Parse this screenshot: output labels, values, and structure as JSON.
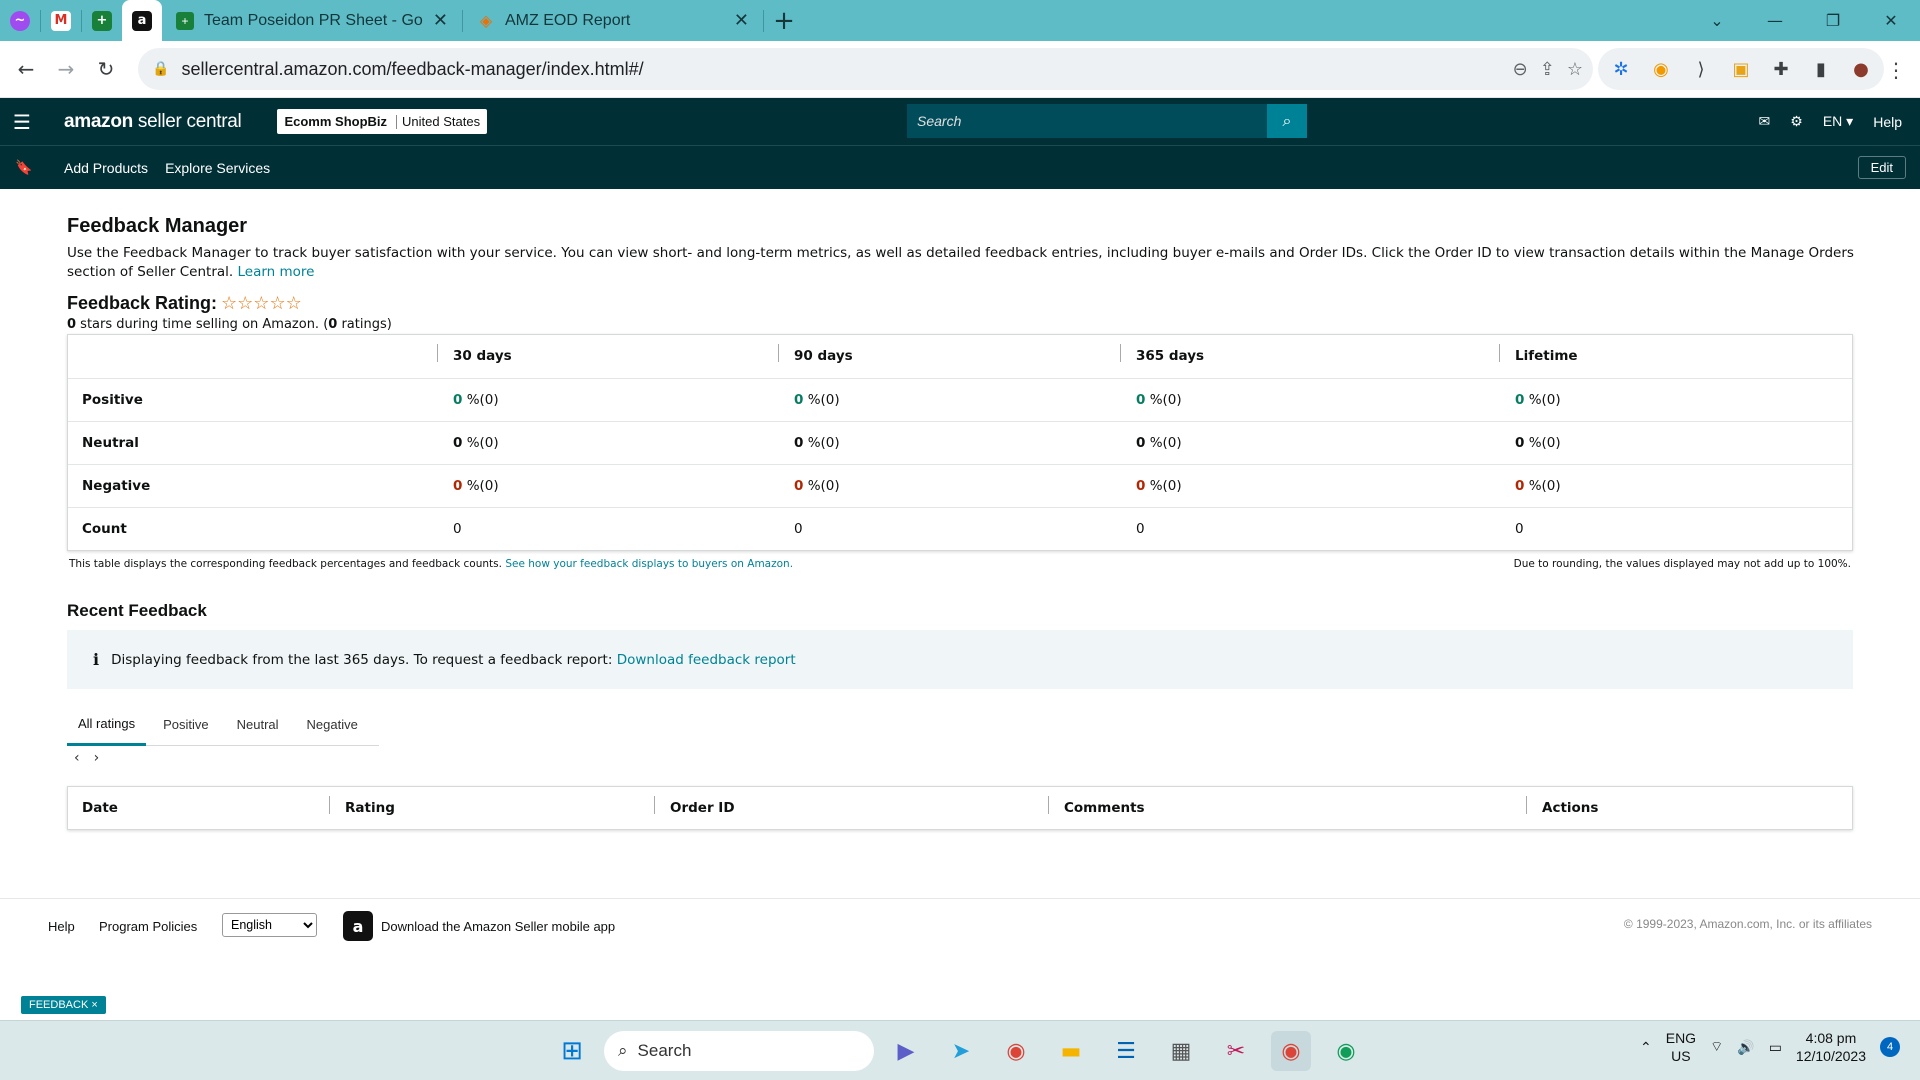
{
  "browser": {
    "tabs": [
      {
        "title": "Team Poseidon PR Sheet - Goog",
        "icon": "google-sheets-icon"
      },
      {
        "title": "AMZ EOD Report",
        "icon": "apps-script-icon"
      }
    ],
    "url": "sellercentral.amazon.com/feedback-manager/index.html#/"
  },
  "header": {
    "logo_main": "amazon",
    "logo_sub": " seller central",
    "store_name": "Ecomm ShopBiz",
    "store_region": "United States",
    "search_placeholder": "Search",
    "language": "EN ▾",
    "help": "Help"
  },
  "subnav": {
    "add_products": "Add Products",
    "explore_services": "Explore Services",
    "edit": "Edit"
  },
  "page": {
    "title": "Feedback Manager",
    "description": "Use the Feedback Manager to track buyer satisfaction with your service. You can view short- and long-term metrics, as well as detailed feedback entries, including buyer e-mails and Order IDs. Click the Order ID to view transaction details within the Manage Orders section of Seller Central.",
    "learn_more": "Learn more",
    "rating_heading": "Feedback Rating:",
    "stars_display": "☆☆☆☆☆",
    "rating_value": "0",
    "rating_text_1": " stars during time selling on Amazon. (",
    "rating_count": "0",
    "rating_text_2": " ratings)"
  },
  "metrics": {
    "columns": [
      "30 days",
      "90 days",
      "365 days",
      "Lifetime"
    ],
    "rows": [
      {
        "label": "Positive",
        "values": [
          "0",
          "0",
          "0",
          "0"
        ],
        "suffix": " %(0)"
      },
      {
        "label": "Neutral",
        "values": [
          "0",
          "0",
          "0",
          "0"
        ],
        "suffix": " %(0)"
      },
      {
        "label": "Negative",
        "values": [
          "0",
          "0",
          "0",
          "0"
        ],
        "suffix": " %(0)"
      },
      {
        "label": "Count",
        "values": [
          "0",
          "0",
          "0",
          "0"
        ],
        "suffix": ""
      }
    ],
    "note": "This table displays the corresponding feedback percentages and feedback counts.",
    "note_link": "See how your feedback displays to buyers on Amazon.",
    "rounding_note": "Due to rounding, the values displayed may not add up to 100%."
  },
  "recent": {
    "title": "Recent Feedback",
    "info_text": "Displaying feedback from the last 365 days. To request a feedback report:",
    "info_link": "Download feedback report",
    "tabs": [
      "All ratings",
      "Positive",
      "Neutral",
      "Negative"
    ],
    "columns": [
      "Date",
      "Rating",
      "Order ID",
      "Comments",
      "Actions"
    ]
  },
  "footer": {
    "help": "Help",
    "policies": "Program Policies",
    "language": "English",
    "app_text": "Download the Amazon Seller mobile app",
    "copyright": "© 1999-2023, Amazon.com, Inc. or its affiliates",
    "feedback_tab": "FEEDBACK ×"
  },
  "taskbar": {
    "search": "Search",
    "lang1": "ENG",
    "lang2": "US",
    "time": "4:08 pm",
    "date": "12/10/2023",
    "notifications": "4"
  }
}
